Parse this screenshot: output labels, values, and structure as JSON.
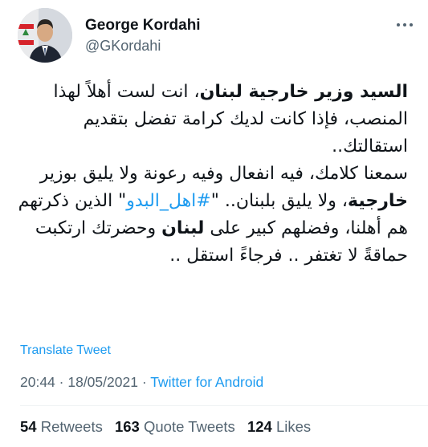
{
  "author": {
    "display_name": "George Kordahi",
    "handle": "@GKordahi"
  },
  "tweet": {
    "p1_bold": "السيد وزير خارجية لبنان",
    "p1_rest": "، انت لست أهلاً لهذا المنصب، فإذا كانت لديك كرامة تفضل بتقديم استقالتك..",
    "p2_a": "سمعنا كلامك، فيه انفعال وفيه رعونة ولا يليق بوزير ",
    "p2_bold1": "خارجية",
    "p2_b": "، ولا يليق بلبنان.. \"",
    "p2_hashtag": "#اهل_البدو",
    "p2_c": "\" الذين ذكرتهم هم أهلنا، وفضلهم كبير على ",
    "p2_bold2": "لبنان",
    "p2_d": " وحضرتك ارتكبت حماقةً لا تغتفر .. فرجاءً استقل .."
  },
  "translate_label": "Translate Tweet",
  "meta": {
    "time": "20:44",
    "separator": " · ",
    "date": "18/05/2021",
    "source": "Twitter for Android"
  },
  "stats": {
    "retweets_count": "54",
    "retweets_label": "Retweets",
    "quotes_count": "163",
    "quotes_label": "Quote Tweets",
    "likes_count": "124",
    "likes_label": "Likes"
  },
  "colors": {
    "link": "#1d9bf0",
    "secondary_text": "#536471",
    "primary_text": "#0f1419"
  },
  "icons": {
    "more": "more-horizontal-icon"
  }
}
